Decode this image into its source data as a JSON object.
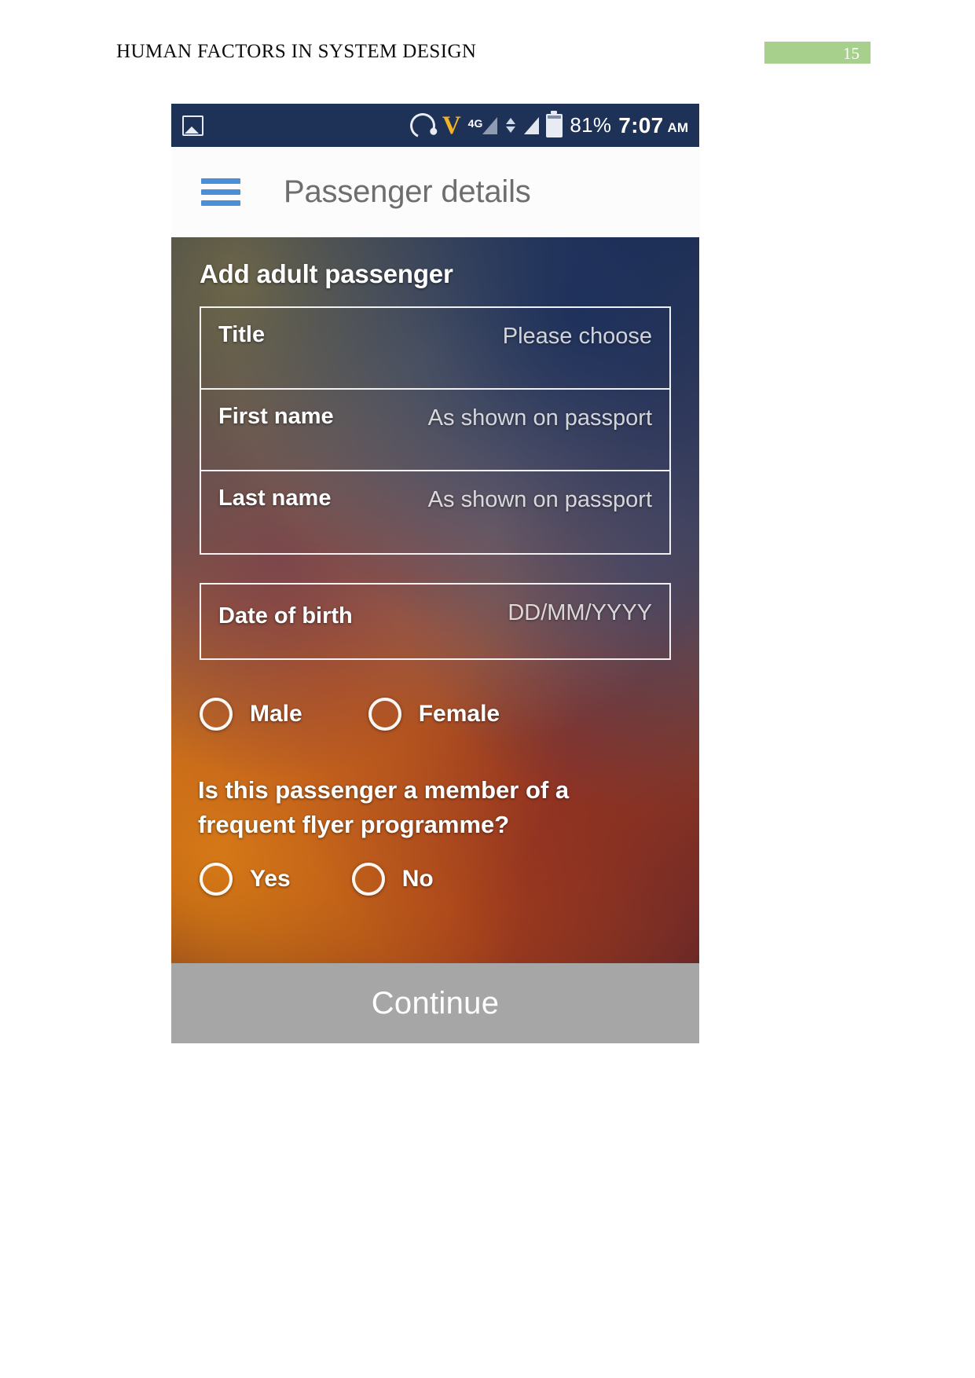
{
  "document": {
    "header_title": "HUMAN FACTORS IN SYSTEM DESIGN",
    "page_number": "15",
    "badge_color": "#a8d08d"
  },
  "phone": {
    "status_bar": {
      "background_color": "#1e3157",
      "network_label": "4G",
      "battery_percent": "81%",
      "time": "7:07",
      "meridiem": "AM",
      "icons": [
        "gallery-icon",
        "headset-icon",
        "viber-icon",
        "signal-icon",
        "data-transfer-icon",
        "signal-icon-2",
        "battery-icon"
      ]
    },
    "app_bar": {
      "menu_icon": "hamburger-menu-icon",
      "menu_color": "#4a90d9",
      "title": "Passenger details"
    },
    "form": {
      "card_title": "Add adult passenger",
      "fields": [
        {
          "label": "Title",
          "value": "Please choose"
        },
        {
          "label": "First name",
          "value": "As shown on passport"
        },
        {
          "label": "Last name",
          "value": "As shown on passport"
        }
      ],
      "dob": {
        "label": "Date of birth",
        "value": "DD/MM/YYYY"
      },
      "gender": {
        "options": [
          {
            "label": "Male",
            "selected": false
          },
          {
            "label": "Female",
            "selected": false
          }
        ]
      },
      "frequent_flyer": {
        "question": "Is this passenger a member of a frequent flyer programme?",
        "options": [
          {
            "label": "Yes",
            "selected": false
          },
          {
            "label": "No",
            "selected": false
          }
        ]
      },
      "continue_button": {
        "label": "Continue",
        "background_color": "#a6a6a6"
      }
    }
  }
}
